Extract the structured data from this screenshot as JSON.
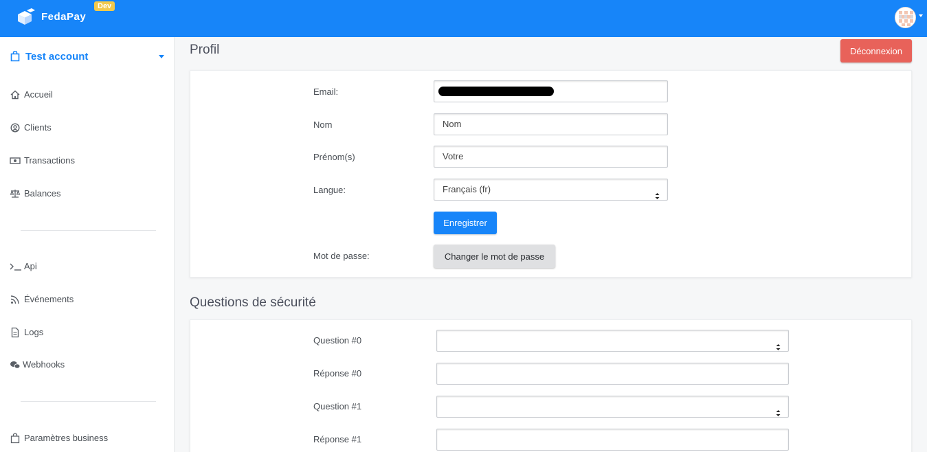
{
  "app": {
    "brand": "FedaPay",
    "env_badge": "Dev",
    "colors": {
      "primary": "#1785f9",
      "danger": "#e8625a",
      "badge": "#f2c94c"
    }
  },
  "sidebar": {
    "account": {
      "label": "Test account",
      "icon": "shopping-bag-icon"
    },
    "items": [
      {
        "label": "Accueil",
        "icon": "home-icon"
      },
      {
        "label": "Clients",
        "icon": "user-circle-icon"
      },
      {
        "label": "Transactions",
        "icon": "money-bill-icon"
      },
      {
        "label": "Balances",
        "icon": "balance-scale-icon"
      },
      {
        "label": "Api",
        "icon": "terminal-icon"
      },
      {
        "label": "Événements",
        "icon": "rss-icon"
      },
      {
        "label": "Logs",
        "icon": "file-icon"
      },
      {
        "label": "Webhooks",
        "icon": "webhooks-icon"
      },
      {
        "label": "Paramètres business",
        "icon": "shopping-bag-icon"
      }
    ]
  },
  "profile": {
    "title": "Profil",
    "logout_label": "Déconnexion",
    "email_label": "Email:",
    "email_value": "",
    "nom_label": "Nom",
    "nom_value": "Nom",
    "prenom_label": "Prénom(s)",
    "prenom_value": "Votre",
    "langue_label": "Langue:",
    "langue_value": "Français (fr)",
    "save_label": "Enregistrer",
    "password_label": "Mot de passe:",
    "change_password_label": "Changer le mot de passe"
  },
  "security": {
    "title": "Questions de sécurité",
    "rows": [
      {
        "question_label": "Question #0",
        "question_value": "",
        "answer_label": "Réponse #0",
        "answer_value": ""
      },
      {
        "question_label": "Question #1",
        "question_value": "",
        "answer_label": "Réponse #1",
        "answer_value": ""
      }
    ]
  }
}
